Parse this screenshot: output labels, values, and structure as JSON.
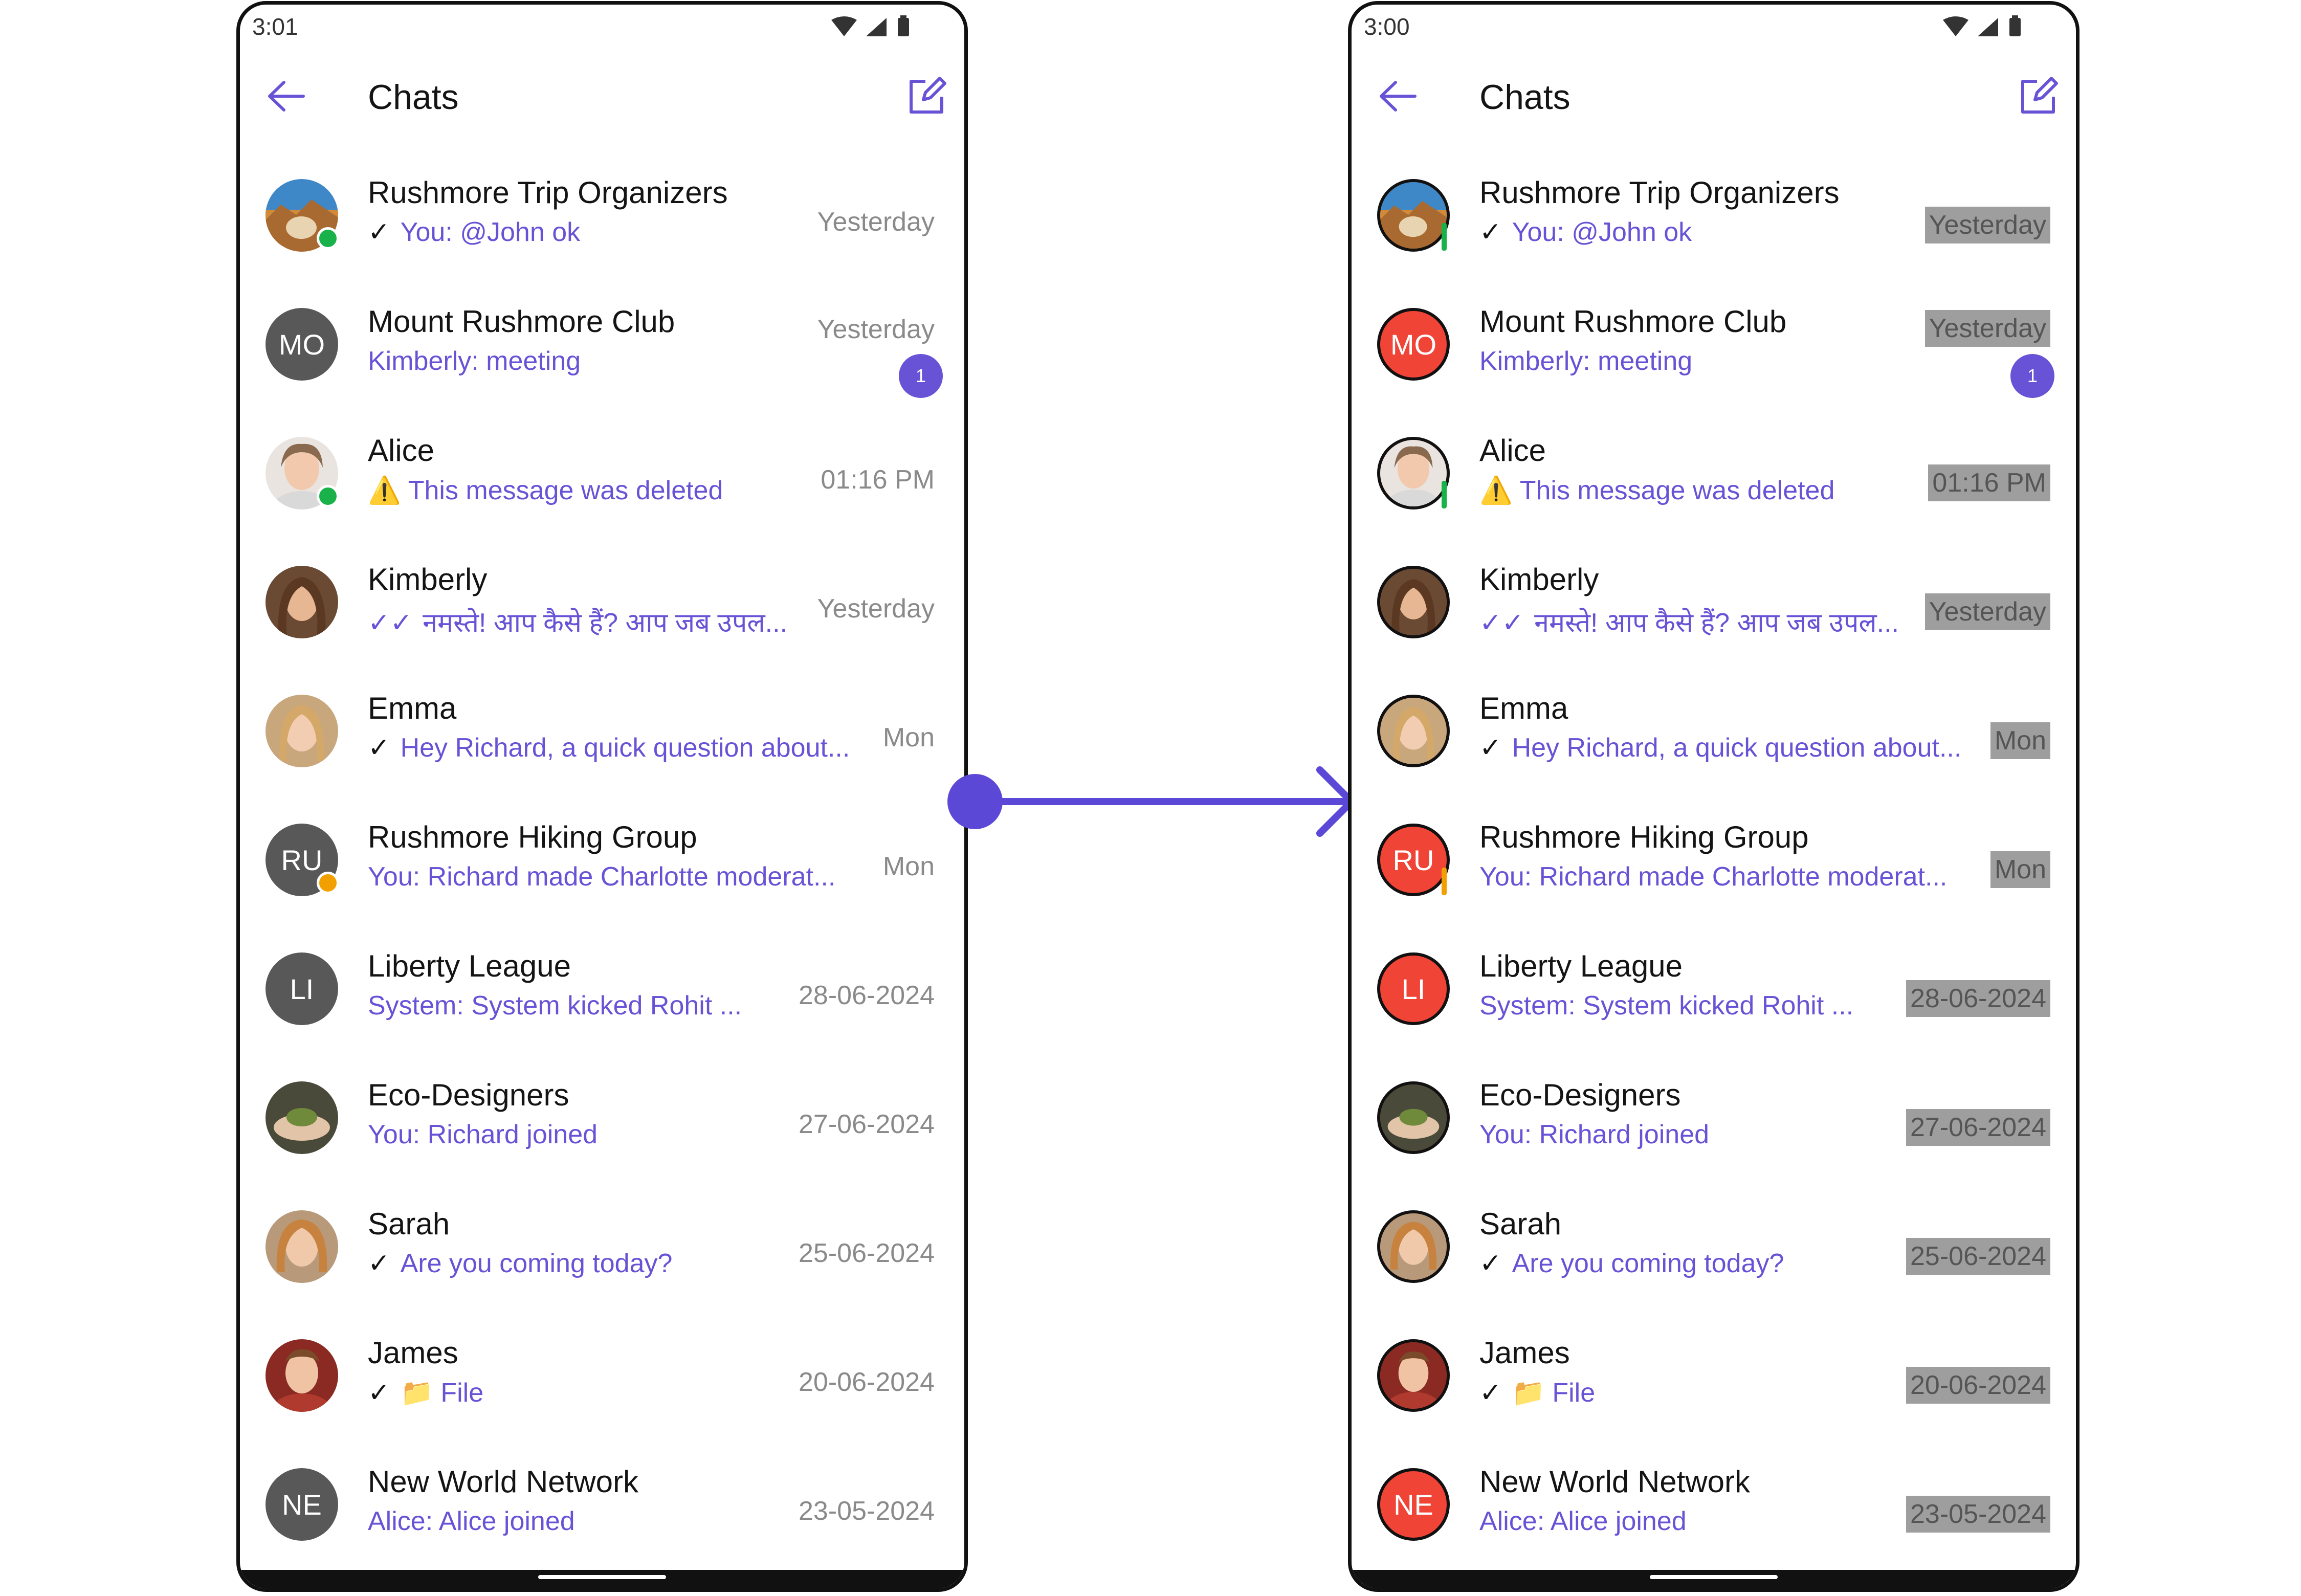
{
  "colors": {
    "accent": "#6852d6",
    "avatar_gray": "#585858",
    "avatar_red": "#f04437",
    "online_green": "#18b14a",
    "lock_orange": "#f2a000",
    "timestamp_highlight": "#9e9e9e"
  },
  "left": {
    "status_time": "3:01",
    "title": "Chats",
    "chats": [
      {
        "name": "Rushmore Trip Organizers",
        "preview": "You: @John ok",
        "time": "Yesterday",
        "avatar": "landscape-photo"
      },
      {
        "name": "Mount Rushmore Club",
        "preview": "Kimberly: meeting",
        "time": "Yesterday",
        "badge": "1",
        "initials": "MO"
      },
      {
        "name": "Alice",
        "preview": "This message was deleted",
        "time": "01:16 PM",
        "avatar": "user-photo"
      },
      {
        "name": "Kimberly",
        "preview": "नमस्ते! आप कैसे हैं?  आप जब उपल...",
        "time": "Yesterday",
        "avatar": "user-photo"
      },
      {
        "name": "Emma",
        "preview": "Hey Richard, a quick question about...",
        "time": "Mon",
        "avatar": "user-photo"
      },
      {
        "name": "Rushmore Hiking Group",
        "preview": "You: Richard made Charlotte moderat...",
        "time": "Mon",
        "initials": "RU"
      },
      {
        "name": "Liberty League",
        "preview": "System: System kicked Rohit ...",
        "time": "28-06-2024",
        "initials": "LI"
      },
      {
        "name": "Eco-Designers",
        "preview": "You: Richard joined",
        "time": "27-06-2024",
        "avatar": "plant-photo"
      },
      {
        "name": "Sarah",
        "preview": "Are you coming today?",
        "time": "25-06-2024",
        "avatar": "user-photo"
      },
      {
        "name": "James",
        "preview": "File",
        "time": "20-06-2024",
        "avatar": "user-photo"
      },
      {
        "name": "New World Network",
        "preview": "Alice: Alice joined",
        "time": "23-05-2024",
        "initials": "NE"
      }
    ]
  },
  "right": {
    "status_time": "3:00",
    "title": "Chats",
    "chats": [
      {
        "name": "Rushmore Trip Organizers",
        "preview": "You: @John ok",
        "time": "Yesterday",
        "avatar": "landscape-photo"
      },
      {
        "name": "Mount Rushmore Club",
        "preview": "Kimberly: meeting",
        "time": "Yesterday",
        "badge": "1",
        "initials": "MO"
      },
      {
        "name": "Alice",
        "preview": "This message was deleted",
        "time": "01:16 PM",
        "avatar": "user-photo"
      },
      {
        "name": "Kimberly",
        "preview": "नमस्ते! आप कैसे हैं?  आप जब उपल...",
        "time": "Yesterday",
        "avatar": "user-photo"
      },
      {
        "name": "Emma",
        "preview": "Hey Richard, a quick question about...",
        "time": "Mon",
        "avatar": "user-photo"
      },
      {
        "name": "Rushmore Hiking Group",
        "preview": "You: Richard made Charlotte moderat...",
        "time": "Mon",
        "initials": "RU"
      },
      {
        "name": "Liberty League",
        "preview": "System: System kicked Rohit ...",
        "time": "28-06-2024",
        "initials": "LI"
      },
      {
        "name": "Eco-Designers",
        "preview": "You: Richard joined",
        "time": "27-06-2024",
        "avatar": "plant-photo"
      },
      {
        "name": "Sarah",
        "preview": "Are you coming today?",
        "time": "25-06-2024",
        "avatar": "user-photo"
      },
      {
        "name": "James",
        "preview": "File",
        "time": "20-06-2024",
        "avatar": "user-photo"
      },
      {
        "name": "New World Network",
        "preview": "Alice: Alice joined",
        "time": "23-05-2024",
        "initials": "NE"
      }
    ]
  }
}
